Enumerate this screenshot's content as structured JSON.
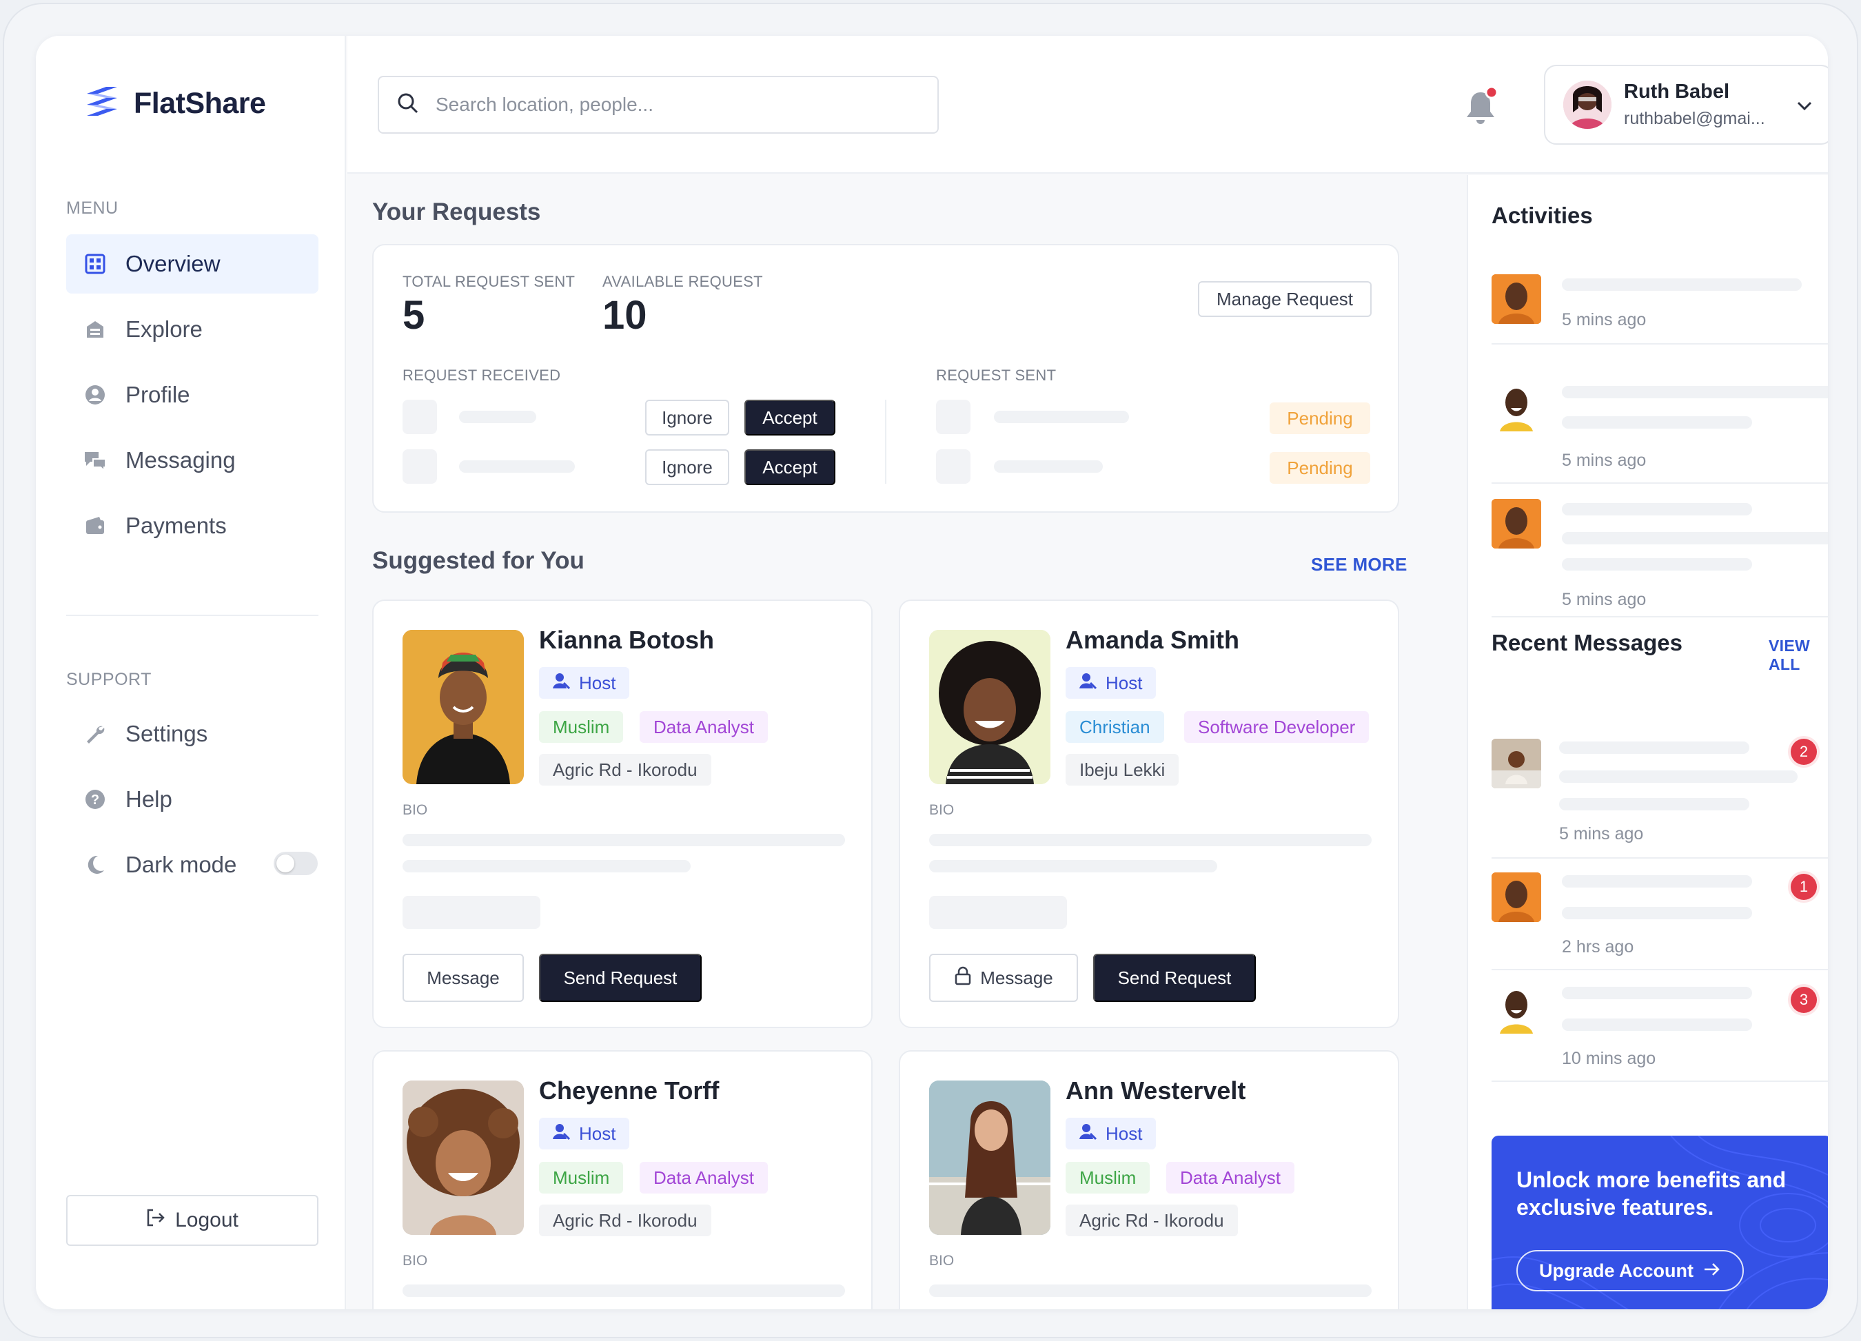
{
  "brand": {
    "name": "FlatShare"
  },
  "sidebar": {
    "menu_label": "MENU",
    "items": [
      {
        "label": "Overview",
        "icon": "grid-icon"
      },
      {
        "label": "Explore",
        "icon": "building-icon"
      },
      {
        "label": "Profile",
        "icon": "user-circle-icon"
      },
      {
        "label": "Messaging",
        "icon": "chat-icon"
      },
      {
        "label": "Payments",
        "icon": "wallet-icon"
      }
    ],
    "support_label": "SUPPORT",
    "support_items": [
      {
        "label": "Settings",
        "icon": "wrench-icon"
      },
      {
        "label": "Help",
        "icon": "help-icon"
      },
      {
        "label": "Dark mode",
        "icon": "moon-icon"
      }
    ],
    "logout_label": "Logout"
  },
  "header": {
    "search_placeholder": "Search location, people...",
    "user_name": "Ruth Babel",
    "user_email": "ruthbabel@gmai..."
  },
  "requests": {
    "title": "Your Requests",
    "total_label": "TOTAL REQUEST SENT",
    "total_value": "5",
    "available_label": "AVAILABLE REQUEST",
    "available_value": "10",
    "manage_label": "Manage Request",
    "received_label": "REQUEST RECEIVED",
    "sent_label": "REQUEST SENT",
    "ignore_label": "Ignore",
    "accept_label": "Accept",
    "pending_label": "Pending"
  },
  "suggested": {
    "title": "Suggested for You",
    "see_more": "SEE MORE",
    "bio_label": "BIO",
    "message_label": "Message",
    "send_label": "Send Request",
    "people": [
      {
        "name": "Kianna Botosh",
        "role": "Host",
        "religion": "Muslim",
        "job": "Data Analyst",
        "location": "Agric Rd - Ikorodu"
      },
      {
        "name": "Amanda Smith",
        "role": "Host",
        "religion": "Christian",
        "job": "Software Developer",
        "location": "Ibeju Lekki"
      },
      {
        "name": "Cheyenne Torff",
        "role": "Host",
        "religion": "Muslim",
        "job": "Data Analyst",
        "location": "Agric Rd - Ikorodu"
      },
      {
        "name": "Ann Westervelt",
        "role": "Host",
        "religion": "Muslim",
        "job": "Data Analyst",
        "location": "Agric Rd - Ikorodu"
      }
    ]
  },
  "activities": {
    "title": "Activities",
    "items": [
      {
        "time": "5 mins ago"
      },
      {
        "time": "5 mins ago"
      },
      {
        "time": "5 mins ago"
      }
    ]
  },
  "messages": {
    "title": "Recent Messages",
    "view_all": "VIEW ALL",
    "items": [
      {
        "time": "5 mins ago",
        "count": "2"
      },
      {
        "time": "2 hrs ago",
        "count": "1"
      },
      {
        "time": "10 mins ago",
        "count": "3"
      }
    ]
  },
  "upgrade": {
    "text": "Unlock more benefits and exclusive features.",
    "button": "Upgrade Account"
  },
  "colors": {
    "accent": "#3451e6",
    "dark_button": "#1b1f33",
    "pending": "#f0a23a",
    "badge": "#e23a4a"
  }
}
